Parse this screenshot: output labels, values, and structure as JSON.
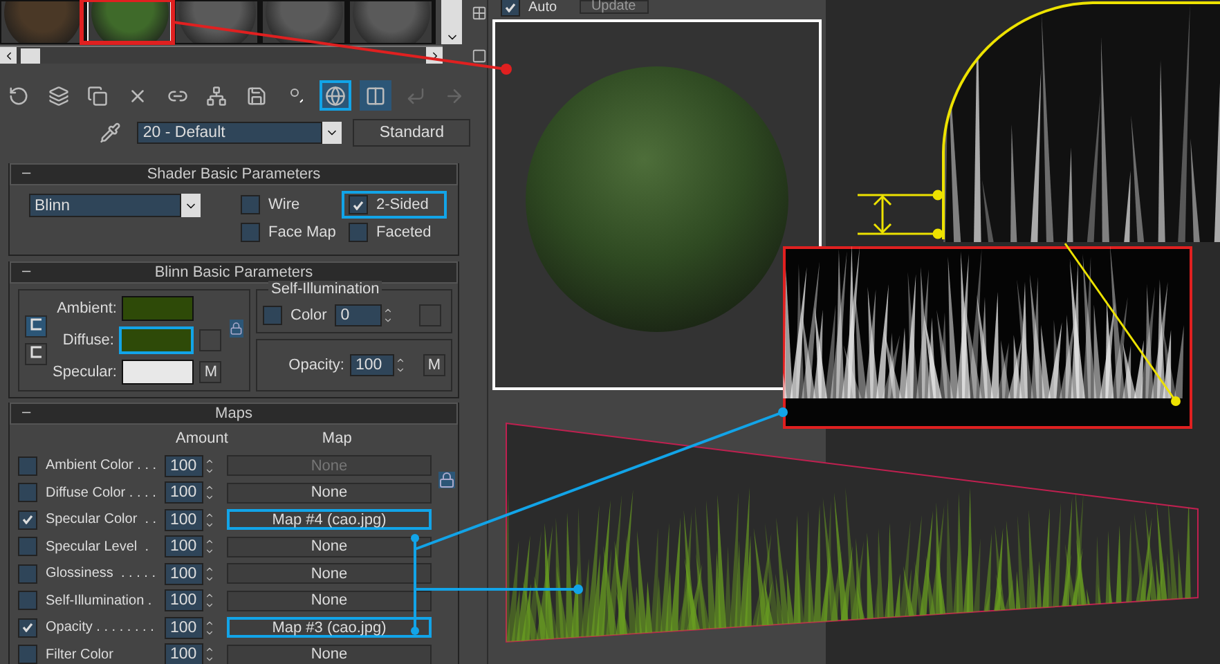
{
  "sample_slots": [
    {
      "color": "#4a3826",
      "selected": false
    },
    {
      "color": "#3f6a2a",
      "selected": true
    },
    {
      "color": "#5a5a5a",
      "selected": false
    },
    {
      "color": "#5a5a5a",
      "selected": false
    },
    {
      "color": "#5a5a5a",
      "selected": false
    }
  ],
  "toolbar_buttons": [
    {
      "active": false,
      "highlighted": false
    },
    {
      "active": false,
      "highlighted": false
    },
    {
      "active": false,
      "highlighted": false
    },
    {
      "active": false,
      "highlighted": false
    },
    {
      "active": false,
      "highlighted": false
    },
    {
      "active": false,
      "highlighted": false
    },
    {
      "active": false,
      "highlighted": false
    },
    {
      "active": false,
      "highlighted": false
    },
    {
      "active": true,
      "highlighted": true
    },
    {
      "active": true,
      "highlighted": false
    },
    {
      "active": false,
      "highlighted": false
    },
    {
      "active": false,
      "highlighted": false
    }
  ],
  "preview": {
    "auto": {
      "label": "Auto",
      "checked": true
    },
    "update_label": "Update"
  },
  "material": {
    "name": "20 - Default",
    "type": "Standard"
  },
  "shader": {
    "collapse_sign": "–",
    "title": "Shader Basic Parameters",
    "type": "Blinn",
    "options": [
      {
        "label": "Wire",
        "checked": false,
        "highlighted": false
      },
      {
        "label": "2-Sided",
        "checked": true,
        "highlighted": true
      },
      {
        "label": "Face Map",
        "checked": false,
        "highlighted": false
      },
      {
        "label": "Faceted",
        "checked": false,
        "highlighted": false
      }
    ]
  },
  "blinn": {
    "collapse_sign": "–",
    "title": "Blinn Basic Parameters",
    "colors": [
      {
        "label": "Ambient:",
        "color": "#2e4a08",
        "highlighted": false
      },
      {
        "label": "Diffuse:",
        "color": "#2e4a08",
        "highlighted": true
      },
      {
        "label": "Specular:",
        "color": "#e8e8e8",
        "highlighted": false
      }
    ],
    "map_button": "M",
    "self_illumination": {
      "title": "Self-Illumination",
      "label": "Color",
      "checked": false,
      "value": "0"
    },
    "opacity": {
      "label": "Opacity:",
      "value": "100",
      "map_button": "M"
    }
  },
  "maps": {
    "collapse_sign": "–",
    "title": "Maps",
    "columns": [
      "Amount",
      "Map"
    ],
    "rows": [
      {
        "label": "Ambient Color . . .",
        "checked": false,
        "amount": "100",
        "map": "None",
        "disabled": true,
        "highlighted": false
      },
      {
        "label": "Diffuse Color . . . .",
        "checked": false,
        "amount": "100",
        "map": "None",
        "disabled": false,
        "highlighted": false
      },
      {
        "label": "Specular Color  . .",
        "checked": true,
        "amount": "100",
        "map": "Map #4 (cao.jpg)",
        "disabled": false,
        "highlighted": true
      },
      {
        "label": "Specular Level  .",
        "checked": false,
        "amount": "100",
        "map": "None",
        "disabled": false,
        "highlighted": false
      },
      {
        "label": "Glossiness  . . . . .",
        "checked": false,
        "amount": "100",
        "map": "None",
        "disabled": false,
        "highlighted": false
      },
      {
        "label": "Self-Illumination .",
        "checked": false,
        "amount": "100",
        "map": "None",
        "disabled": false,
        "highlighted": false
      },
      {
        "label": "Opacity . . . . . . . .",
        "checked": true,
        "amount": "100",
        "map": "Map #3 (cao.jpg)",
        "disabled": false,
        "highlighted": true
      },
      {
        "label": "Filter Color",
        "checked": false,
        "amount": "100",
        "map": "None",
        "disabled": false,
        "highlighted": false
      }
    ]
  }
}
